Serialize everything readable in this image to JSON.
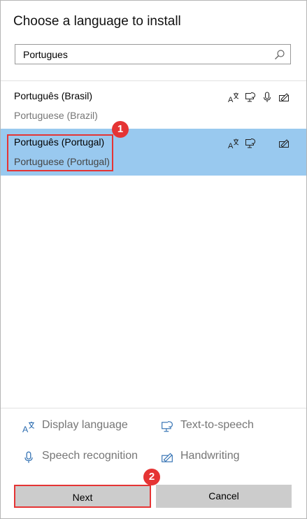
{
  "dialog": {
    "title": "Choose a language to install"
  },
  "search": {
    "value": "Portugues",
    "icon": "search-icon"
  },
  "languages": [
    {
      "native": "Português (Brasil)",
      "english": "Portuguese (Brazil)",
      "selected": false,
      "features": [
        "display-language",
        "text-to-speech",
        "speech-recognition",
        "handwriting"
      ]
    },
    {
      "native": "Português (Portugal)",
      "english": "Portuguese (Portugal)",
      "selected": true,
      "features": [
        "display-language",
        "text-to-speech",
        "handwriting"
      ]
    }
  ],
  "legend": {
    "display_language": "Display language",
    "text_to_speech": "Text-to-speech",
    "speech_recognition": "Speech recognition",
    "handwriting": "Handwriting"
  },
  "buttons": {
    "next": "Next",
    "cancel": "Cancel"
  },
  "annotations": {
    "step1": "1",
    "step2": "2"
  },
  "colors": {
    "selected_bg": "#99c9ef",
    "callout": "#e53434",
    "accent_icon": "#2b6cb0",
    "button_bg": "#cccccc"
  }
}
